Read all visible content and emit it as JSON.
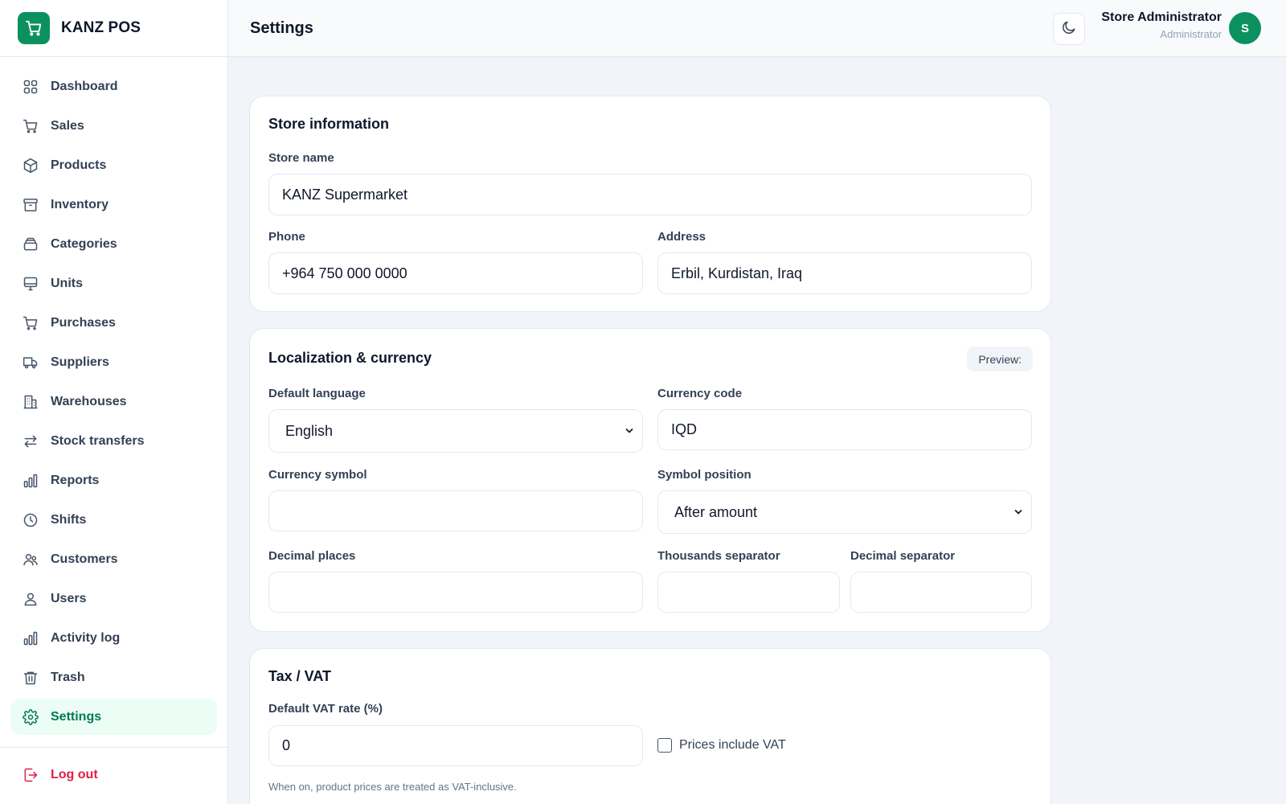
{
  "brand": {
    "name": "KANZ POS",
    "icon": "cart-icon"
  },
  "sidebar": {
    "items": [
      {
        "label": "Dashboard",
        "icon": "grid-icon"
      },
      {
        "label": "Sales",
        "icon": "cart-icon"
      },
      {
        "label": "Products",
        "icon": "box-icon"
      },
      {
        "label": "Inventory",
        "icon": "archive-icon"
      },
      {
        "label": "Categories",
        "icon": "layers-icon"
      },
      {
        "label": "Units",
        "icon": "monitor-icon"
      },
      {
        "label": "Purchases",
        "icon": "cart-icon"
      },
      {
        "label": "Suppliers",
        "icon": "truck-icon"
      },
      {
        "label": "Warehouses",
        "icon": "building-icon"
      },
      {
        "label": "Stock transfers",
        "icon": "arrows-icon"
      },
      {
        "label": "Reports",
        "icon": "bar-chart-icon"
      },
      {
        "label": "Shifts",
        "icon": "clock-icon"
      },
      {
        "label": "Customers",
        "icon": "users-icon"
      },
      {
        "label": "Users",
        "icon": "user-icon"
      },
      {
        "label": "Activity log",
        "icon": "bar-chart-icon"
      },
      {
        "label": "Trash",
        "icon": "trash-icon"
      },
      {
        "label": "Settings",
        "icon": "gear-icon",
        "active": true
      }
    ],
    "logout": {
      "label": "Log out",
      "icon": "logout-icon"
    }
  },
  "header": {
    "title": "Settings",
    "theme_toggle_icon": "moon-icon",
    "user_name": "Store Administrator",
    "user_role": "Administrator",
    "avatar_initial": "S"
  },
  "store_info": {
    "title": "Store information",
    "store_name_label": "Store name",
    "store_name_value": "KANZ Supermarket",
    "phone_label": "Phone",
    "phone_value": "+964 750 000 0000",
    "address_label": "Address",
    "address_value": "Erbil, Kurdistan, Iraq"
  },
  "localization": {
    "title": "Localization & currency",
    "preview_label": "Preview:",
    "language_label": "Default language",
    "language_value": "English",
    "currency_code_label": "Currency code",
    "currency_code_value": "IQD",
    "currency_symbol_label": "Currency symbol",
    "currency_symbol_value": "",
    "symbol_position_label": "Symbol position",
    "symbol_position_value": "After amount",
    "decimal_places_label": "Decimal places",
    "decimal_places_value": "",
    "thousands_sep_label": "Thousands separator",
    "thousands_sep_value": "",
    "decimal_sep_label": "Decimal separator",
    "decimal_sep_value": ""
  },
  "tax": {
    "title": "Tax / VAT",
    "vat_rate_label": "Default VAT rate (%)",
    "vat_rate_value": "0",
    "prices_include_label": "Prices include VAT",
    "prices_include_checked": false,
    "hint": "When on, product prices are treated as VAT-inclusive."
  },
  "colors": {
    "accent": "#0b9160",
    "active_bg": "#ecfdf5",
    "danger": "#e11d48"
  }
}
